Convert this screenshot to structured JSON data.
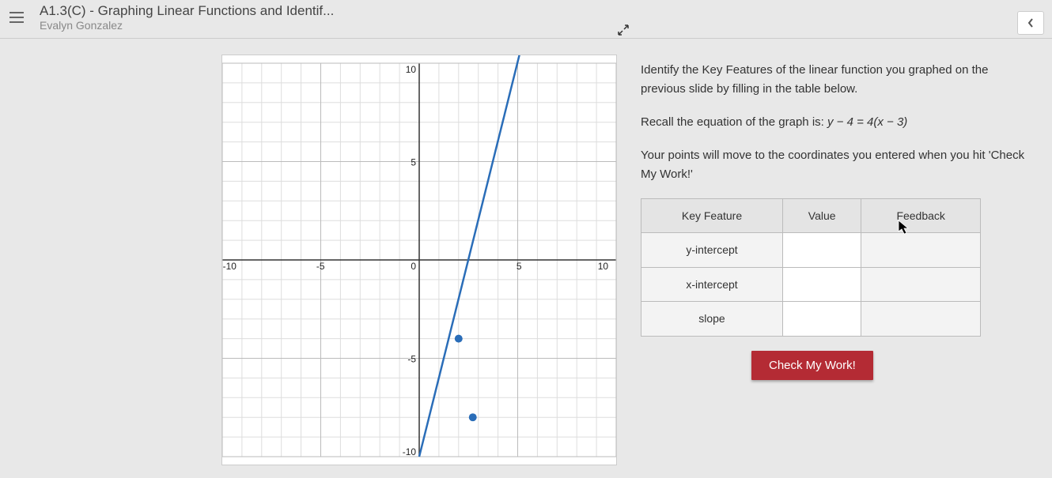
{
  "header": {
    "title": "A1.3(C) - Graphing Linear Functions and Identif...",
    "subtitle": "Evalyn Gonzalez"
  },
  "instructions": {
    "p1": "Identify the Key Features of the linear function you graphed on the previous slide by filling in the table below.",
    "p2_prefix": "Recall the equation of the graph is: ",
    "equation": "y − 4 = 4(x − 3)",
    "p3": "Your points will move to the coordinates you entered when you hit 'Check My Work!'"
  },
  "table": {
    "headers": {
      "feature": "Key Feature",
      "value": "Value",
      "feedback": "Feedback"
    },
    "rows": [
      {
        "feature": "y-intercept",
        "value": "",
        "feedback": ""
      },
      {
        "feature": "x-intercept",
        "value": "",
        "feedback": ""
      },
      {
        "feature": "slope",
        "value": "",
        "feedback": ""
      }
    ]
  },
  "button": {
    "check": "Check My Work!"
  },
  "chart_data": {
    "type": "line",
    "xlim": [
      -10,
      10
    ],
    "ylim": [
      -10,
      10
    ],
    "x_ticks": [
      -10,
      -5,
      0,
      5,
      10
    ],
    "y_ticks": [
      -10,
      -5,
      0,
      5,
      10
    ],
    "grid": true,
    "equation": "y - 4 = 4(x - 3)",
    "series": [
      {
        "name": "linear function",
        "x": [
          0,
          5.5
        ],
        "y": [
          -10,
          12
        ]
      }
    ],
    "points": [
      {
        "x": 2,
        "y": -4
      },
      {
        "x": 2.75,
        "y": -8
      }
    ]
  }
}
